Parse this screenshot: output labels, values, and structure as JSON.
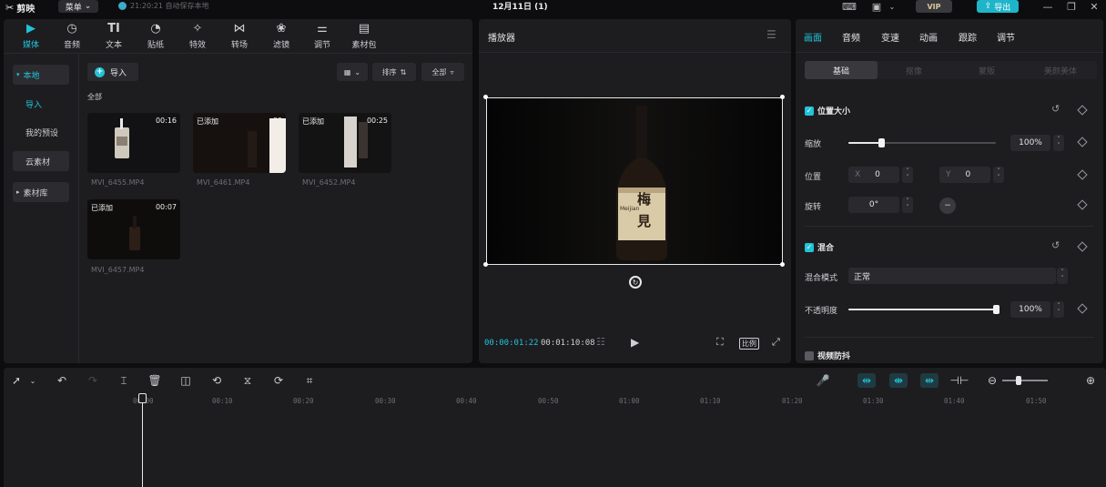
{
  "topbar": {
    "logo_text": "剪映",
    "menu_label": "菜单",
    "autosave_text": "21:20:21 自动保存本地",
    "project_title": "12月11日 (1)",
    "vip_label": "VIP",
    "export_label": "导出"
  },
  "media": {
    "tabs": [
      {
        "label": "媒体",
        "icon": "media-icon"
      },
      {
        "label": "音频",
        "icon": "audio-icon"
      },
      {
        "label": "文本",
        "icon": "text-icon"
      },
      {
        "label": "贴纸",
        "icon": "sticker-icon"
      },
      {
        "label": "特效",
        "icon": "effects-icon"
      },
      {
        "label": "转场",
        "icon": "transition-icon"
      },
      {
        "label": "滤镜",
        "icon": "filter-icon"
      },
      {
        "label": "调节",
        "icon": "adjust-icon"
      },
      {
        "label": "素材包",
        "icon": "package-icon"
      }
    ],
    "sidebar": {
      "local": "本地",
      "import": "导入",
      "my_presets": "我的预设",
      "cloud": "云素材",
      "library": "素材库"
    },
    "import_button": "导入",
    "sort_label": "排序",
    "filter_label": "全部",
    "all_label": "全部",
    "clips": [
      {
        "name": "MVI_6455.MP4",
        "duration": "00:16",
        "added": ""
      },
      {
        "name": "MVI_6461.MP4",
        "duration": "00",
        "added": "已添加"
      },
      {
        "name": "MVI_6452.MP4",
        "duration": "00:25",
        "added": "已添加"
      },
      {
        "name": "MVI_6457.MP4",
        "duration": "00:07",
        "added": "已添加"
      }
    ]
  },
  "player": {
    "title": "播放器",
    "current_time": "00:00:01:22",
    "total_time": "00:01:10:08",
    "bottle_label_top": "梅",
    "bottle_label_bottom": "見",
    "bottle_brand": "Meijian"
  },
  "props": {
    "tabs": [
      "画面",
      "音频",
      "变速",
      "动画",
      "跟踪",
      "调节"
    ],
    "subtabs": [
      "基础",
      "抠像",
      "蒙版",
      "美颜美体"
    ],
    "position_size": {
      "title": "位置大小",
      "scale_label": "缩放",
      "scale_value": "100%",
      "scale_level": 0.22,
      "position_label": "位置",
      "x_label": "X",
      "x_value": "0",
      "y_label": "Y",
      "y_value": "0",
      "rotate_label": "旋转",
      "rotate_value": "0°"
    },
    "blend": {
      "title": "混合",
      "mode_label": "混合模式",
      "mode_value": "正常",
      "opacity_label": "不透明度",
      "opacity_value": "100%",
      "opacity_level": 1.0
    },
    "stabilize": {
      "title": "视频防抖"
    }
  },
  "timeline": {
    "ruler_ticks": [
      "00:00",
      "00:10",
      "00:20",
      "00:30",
      "00:40",
      "00:50",
      "01:00",
      "01:10",
      "01:20",
      "01:30",
      "01:40",
      "01:50"
    ]
  },
  "colors": {
    "accent": "#22c3d8",
    "panel": "#1d1d20",
    "background": "#0d0d0f"
  }
}
